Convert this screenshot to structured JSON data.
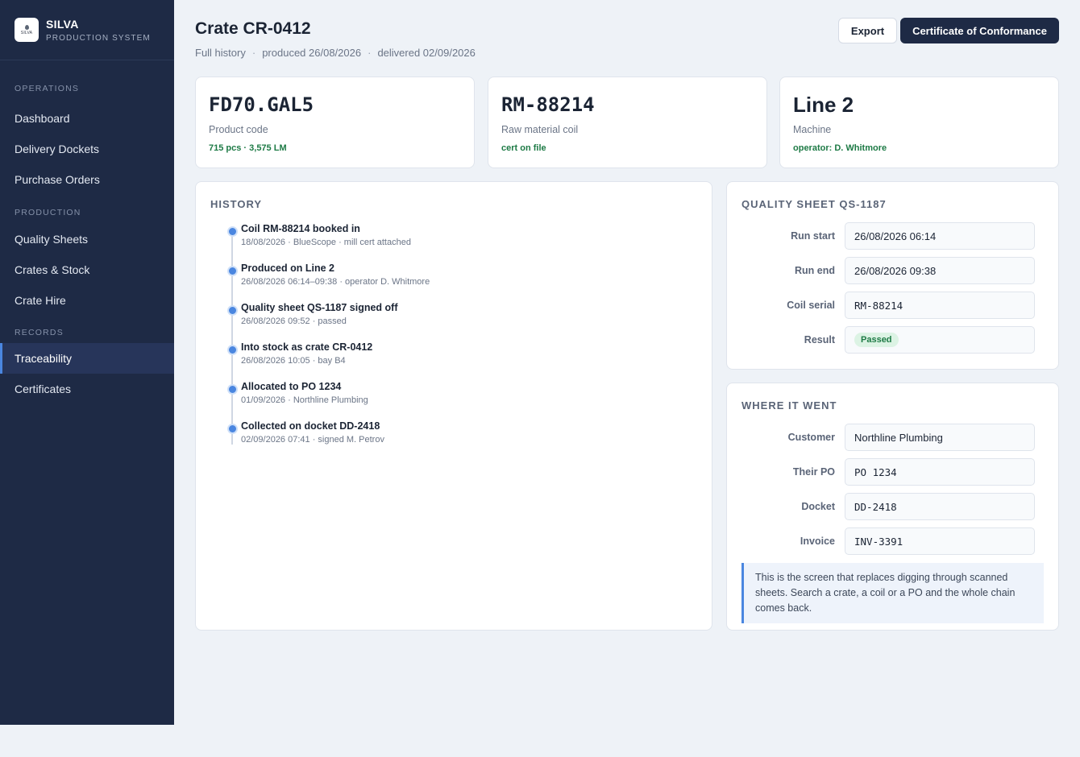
{
  "brand": {
    "name": "SILVA",
    "subtitle": "PRODUCTION SYSTEM",
    "logo_text": "SILVA"
  },
  "sidebar": {
    "sections": [
      {
        "title": "OPERATIONS",
        "items": [
          "Dashboard",
          "Delivery Dockets",
          "Purchase Orders"
        ]
      },
      {
        "title": "PRODUCTION",
        "items": [
          "Quality Sheets",
          "Crates & Stock",
          "Crate Hire"
        ]
      },
      {
        "title": "RECORDS",
        "items": [
          "Traceability",
          "Certificates"
        ]
      }
    ],
    "active": "Traceability"
  },
  "header": {
    "title": "Crate CR-0412",
    "sub": [
      "Full history",
      "produced 26/08/2026",
      "delivered 02/09/2026"
    ],
    "separator": "·",
    "export_label": "Export",
    "coc_label": "Certificate of Conformance"
  },
  "stats": [
    {
      "value": "FD70.GAL5",
      "label": "Product code",
      "note": "715 pcs · 3,575 LM"
    },
    {
      "value": "RM-88214",
      "label": "Raw material coil",
      "note": "cert on file"
    },
    {
      "value": "Line 2",
      "label": "Machine",
      "note": "operator: D. Whitmore"
    }
  ],
  "history": {
    "title": "HISTORY",
    "items": [
      {
        "title": "Coil RM-88214 booked in",
        "meta": "18/08/2026  ·  BlueScope · mill cert attached"
      },
      {
        "title": "Produced on Line 2",
        "meta": "26/08/2026 06:14–09:38  ·  operator D. Whitmore"
      },
      {
        "title": "Quality sheet QS-1187 signed off",
        "meta": "26/08/2026 09:52  ·  passed"
      },
      {
        "title": "Into stock as crate CR-0412",
        "meta": "26/08/2026 10:05  ·  bay B4"
      },
      {
        "title": "Allocated to PO 1234",
        "meta": "01/09/2026  ·  Northline Plumbing"
      },
      {
        "title": "Collected on docket DD-2418",
        "meta": "02/09/2026 07:41  ·  signed M. Petrov"
      }
    ]
  },
  "quality": {
    "title": "QUALITY SHEET QS-1187",
    "run_start_label": "Run start",
    "run_start": "26/08/2026 06:14",
    "run_end_label": "Run end",
    "run_end": "26/08/2026 09:38",
    "coil_label": "Coil serial",
    "coil": "RM-88214",
    "result_label": "Result",
    "result": "Passed"
  },
  "where": {
    "title": "WHERE IT WENT",
    "customer_label": "Customer",
    "customer": "Northline Plumbing",
    "po_label": "Their PO",
    "po": "PO 1234",
    "docket_label": "Docket",
    "docket": "DD-2418",
    "invoice_label": "Invoice",
    "invoice": "INV-3391",
    "note": "This is the screen that replaces digging through scanned sheets. Search a crate, a coil or a PO and the whole chain comes back."
  },
  "colors": {
    "sidebar": "#1e2a45",
    "accent": "#4a86e0",
    "success": "#1d7a45",
    "background": "#eef2f7"
  }
}
